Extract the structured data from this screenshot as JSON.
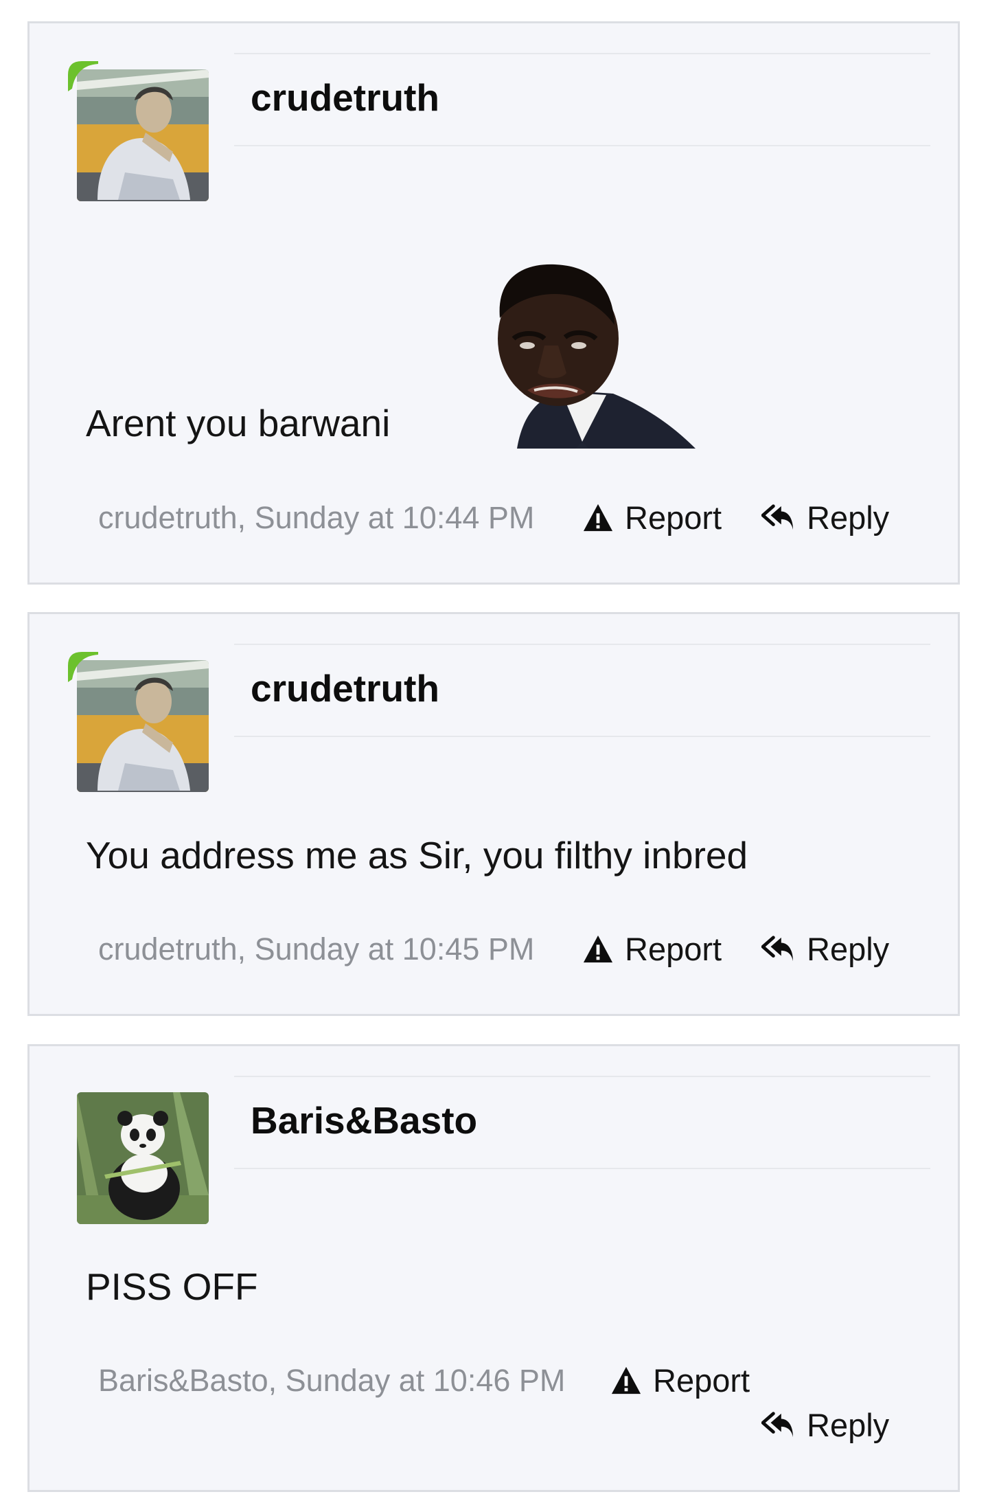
{
  "posts": [
    {
      "username": "crudetruth",
      "message": "Arent you barwani",
      "meta": "crudetruth, Sunday at 10:44 PM",
      "report_label": "Report",
      "reply_label": "Reply",
      "avatar": "anime-man-avatar",
      "online": true,
      "has_image": true
    },
    {
      "username": "crudetruth",
      "message": "You address me as Sir, you filthy inbred",
      "meta": "crudetruth, Sunday at 10:45 PM",
      "report_label": "Report",
      "reply_label": "Reply",
      "avatar": "anime-man-avatar",
      "online": true
    },
    {
      "username": "Baris&Basto",
      "message": "PISS OFF",
      "meta": "Baris&Basto, Sunday at 10:46 PM",
      "report_label": "Report",
      "reply_label": "Reply",
      "avatar": "panda-avatar",
      "online": false
    }
  ],
  "colors": {
    "post_bg": "#f5f6fa",
    "border": "#dcdee3",
    "meta_text": "#8d9096",
    "online": "#6cc12d"
  }
}
